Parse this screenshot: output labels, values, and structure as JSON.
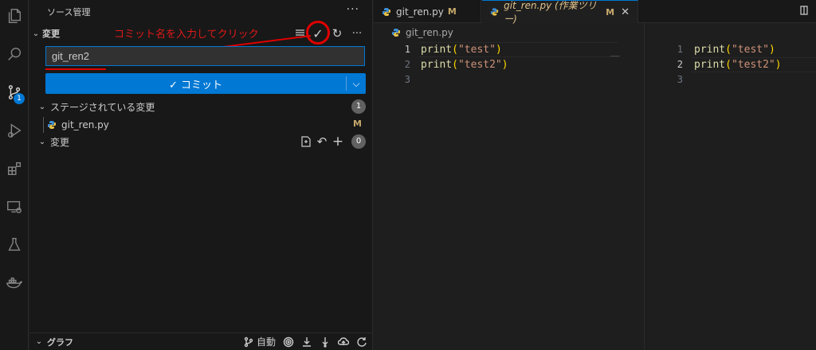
{
  "sidebar": {
    "title": "ソース管理",
    "more": "···",
    "changes_section": {
      "label": "変更",
      "annotation": "コミット名を入力してクリック"
    },
    "commit_input": {
      "value": "git_ren2"
    },
    "commit_button": {
      "label": "✓ コミット",
      "dropdown": "⌵"
    },
    "staged": {
      "label": "ステージされている変更",
      "count": "1",
      "files": [
        {
          "name": "git_ren.py",
          "status": "M"
        }
      ]
    },
    "unstaged": {
      "label": "変更",
      "count": "0"
    },
    "graph": {
      "label": "グラフ",
      "auto_label": "自動"
    }
  },
  "editor": {
    "tabs": [
      {
        "name": "git_ren.py",
        "mark": "M"
      },
      {
        "name": "git_ren.py (作業ツリー)",
        "mark": "M",
        "close": "✕"
      }
    ],
    "breadcrumb": "git_ren.py",
    "left_pane": {
      "lines": [
        {
          "num": "1",
          "fn": "print",
          "open": "(",
          "str": "\"test\"",
          "close": ")"
        },
        {
          "num": "2",
          "fn": "print",
          "open": "(",
          "str": "\"test2\"",
          "close": ")"
        },
        {
          "num": "3"
        }
      ]
    },
    "right_pane": {
      "lines": [
        {
          "num": "1",
          "fn": "print",
          "open": "(",
          "str": "\"test\"",
          "close": ")"
        },
        {
          "num": "2",
          "fn": "print",
          "open": "(",
          "str": "\"test2\"",
          "close": ")"
        },
        {
          "num": "3"
        }
      ]
    }
  },
  "activity_bar": {
    "icons": [
      "explorer-icon",
      "search-icon",
      "source-control-icon",
      "run-debug-icon",
      "extensions-icon",
      "remote-explorer-icon",
      "testing-icon",
      "docker-icon"
    ],
    "scm_badge": "1"
  },
  "colors": {
    "accent": "#0078d4",
    "annotation": "#e00000",
    "modified": "#c5a96b"
  }
}
